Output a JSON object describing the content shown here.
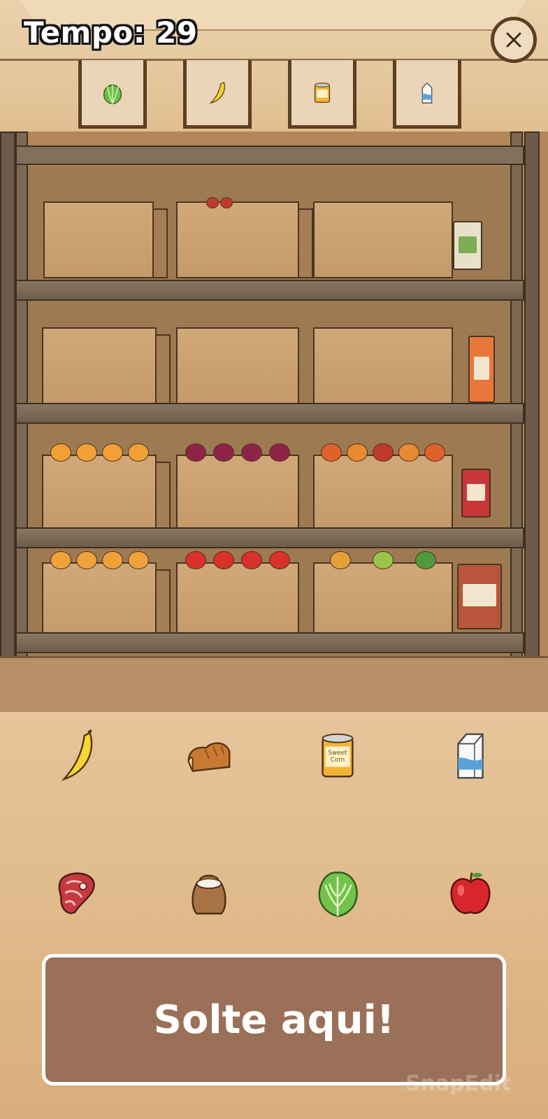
{
  "hud": {
    "timer_text": "Tempo: 29",
    "close_icon": "close-icon"
  },
  "targets": [
    {
      "name": "lettuce",
      "icon": "lettuce-icon"
    },
    {
      "name": "banana",
      "icon": "banana-icon"
    },
    {
      "name": "canned-corn",
      "icon": "can-icon"
    },
    {
      "name": "milk",
      "icon": "milk-carton-icon"
    }
  ],
  "pantry_items": [
    {
      "name": "banana",
      "icon": "banana-icon"
    },
    {
      "name": "bread",
      "icon": "bread-icon"
    },
    {
      "name": "canned-corn",
      "icon": "can-icon",
      "label_lines": [
        "Sweet",
        "Corn"
      ]
    },
    {
      "name": "milk",
      "icon": "milk-carton-icon"
    },
    {
      "name": "meat",
      "icon": "steak-icon"
    },
    {
      "name": "flour",
      "icon": "sack-icon"
    },
    {
      "name": "lettuce",
      "icon": "lettuce-icon"
    },
    {
      "name": "apple",
      "icon": "apple-icon"
    }
  ],
  "drop_zone": {
    "label": "Solte aqui!"
  },
  "watermark": "SnapEdit",
  "colors": {
    "wood_dark": "#5e3f22",
    "drop_zone": "#9a7058",
    "floor": "#e0bb8c"
  }
}
